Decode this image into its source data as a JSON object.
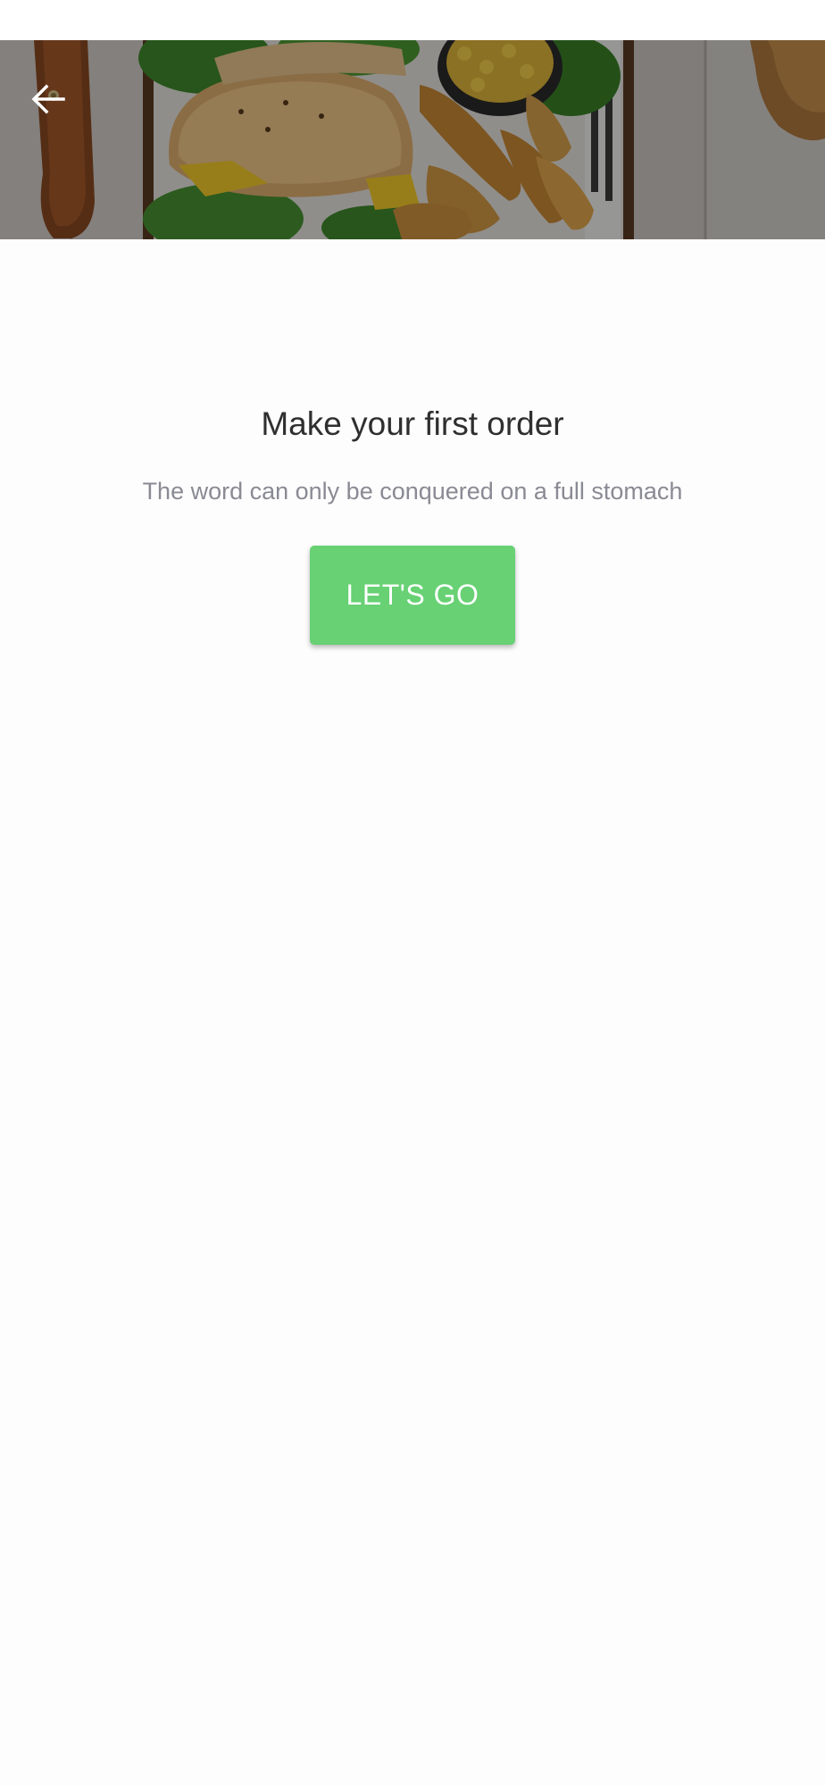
{
  "header": {
    "back_icon": "arrow-left-icon",
    "hero_image": "food-tray-photo"
  },
  "main": {
    "title": "Make your first order",
    "subtitle": "The word can only be conquered on a full stomach",
    "cta_label": "LET'S GO"
  },
  "colors": {
    "accent": "#67d173",
    "title_text": "#2f2f2f",
    "subtitle_text": "#8a8a94",
    "background": "#fdfdfd"
  }
}
